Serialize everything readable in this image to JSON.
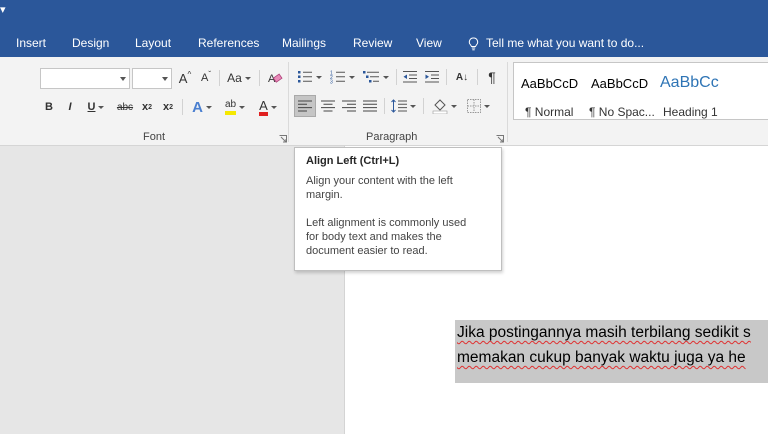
{
  "colors": {
    "accent": "#2b579a",
    "ribbon_bg": "#f3f3f3",
    "doc_bg": "#e6e6e6",
    "selection": "#c8c8c8",
    "font_color_red": "#e02020",
    "highlight_yellow": "#f5e800"
  },
  "tabs": [
    "Insert",
    "Design",
    "Layout",
    "References",
    "Mailings",
    "Review",
    "View"
  ],
  "tell_me": {
    "icon": "lightbulb-icon",
    "placeholder": "Tell me what you want to do..."
  },
  "font_group": {
    "label": "Font",
    "font_name": "",
    "font_size": "",
    "grow_font": "A",
    "shrink_font": "A",
    "change_case": "Aa",
    "bold": "B",
    "italic": "I",
    "underline": "U",
    "strikethrough": "abc",
    "subscript": "x",
    "superscript": "x",
    "sub_mark": "2",
    "sup_mark": "2",
    "text_effects": "A",
    "highlight": "ab",
    "font_color": "A"
  },
  "paragraph_group": {
    "label": "Paragraph",
    "sort": "A↓",
    "show_marks": "¶"
  },
  "styles": [
    {
      "sample": "AaBbCcD",
      "name": "¶ Normal"
    },
    {
      "sample": "AaBbCcD",
      "name": "¶ No Spac..."
    },
    {
      "sample": "AaBbCc",
      "name": "Heading 1"
    }
  ],
  "tooltip": {
    "title": "Align Left (Ctrl+L)",
    "line1": "Align your content with the left",
    "line2": "margin.",
    "line3": "Left alignment is commonly used",
    "line4": "for body text and makes the",
    "line5": "document easier to read."
  },
  "document": {
    "line1": "Jika postingannya masih terbilang sedikit s",
    "line2": "memakan cukup banyak waktu juga ya he"
  }
}
